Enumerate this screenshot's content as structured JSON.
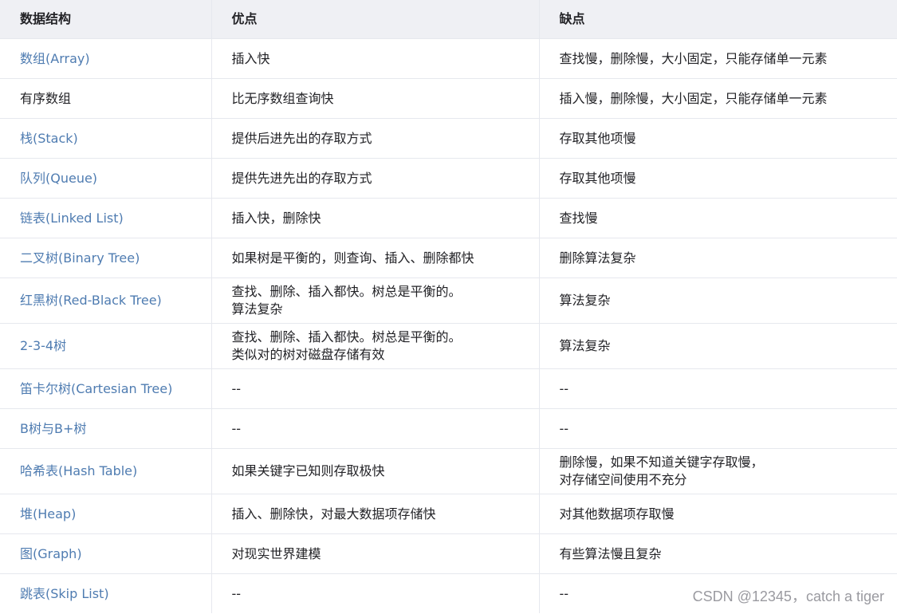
{
  "headers": {
    "structure": "数据结构",
    "pros": "优点",
    "cons": "缺点"
  },
  "rows": [
    {
      "name": "数组(Array)",
      "pros": "插入快",
      "cons": "查找慢，删除慢，大小固定，只能存储单一元素",
      "link": true
    },
    {
      "name": "有序数组",
      "pros": "比无序数组查询快",
      "cons": "插入慢，删除慢，大小固定，只能存储单一元素",
      "link": false
    },
    {
      "name": "栈(Stack)",
      "pros": "提供后进先出的存取方式",
      "cons": "存取其他项慢",
      "link": true
    },
    {
      "name": "队列(Queue)",
      "pros": "提供先进先出的存取方式",
      "cons": "存取其他项慢",
      "link": true
    },
    {
      "name": "链表(Linked List)",
      "pros": "插入快，删除快",
      "cons": "查找慢",
      "link": true
    },
    {
      "name": "二叉树(Binary Tree)",
      "pros": "如果树是平衡的，则查询、插入、删除都快",
      "cons": "删除算法复杂",
      "link": true
    },
    {
      "name": "红黑树(Red-Black Tree)",
      "pros": "查找、删除、插入都快。树总是平衡的。\n算法复杂",
      "cons": "算法复杂",
      "link": true
    },
    {
      "name": "2-3-4树",
      "pros": "查找、删除、插入都快。树总是平衡的。\n类似对的树对磁盘存储有效",
      "cons": "算法复杂",
      "link": true
    },
    {
      "name": "笛卡尔树(Cartesian Tree)",
      "pros": "--",
      "cons": "--",
      "link": true
    },
    {
      "name": "B树与B+树",
      "pros": "--",
      "cons": "--",
      "link": true
    },
    {
      "name": "哈希表(Hash Table)",
      "pros": "如果关键字已知则存取极快",
      "cons": "删除慢，如果不知道关键字存取慢，\n对存储空间使用不充分",
      "link": true
    },
    {
      "name": "堆(Heap)",
      "pros": "插入、删除快，对最大数据项存储快",
      "cons": "对其他数据项存取慢",
      "link": true
    },
    {
      "name": "图(Graph)",
      "pros": "对现实世界建模",
      "cons": "有些算法慢且复杂",
      "link": true
    },
    {
      "name": "跳表(Skip List)",
      "pros": "--",
      "cons": "--",
      "link": true
    }
  ],
  "watermark": "CSDN @12345，catch a tiger",
  "colors": {
    "link": "#4f7cb1",
    "header_bg": "#eff0f4",
    "border": "#e6e8ee",
    "text": "#222226"
  }
}
